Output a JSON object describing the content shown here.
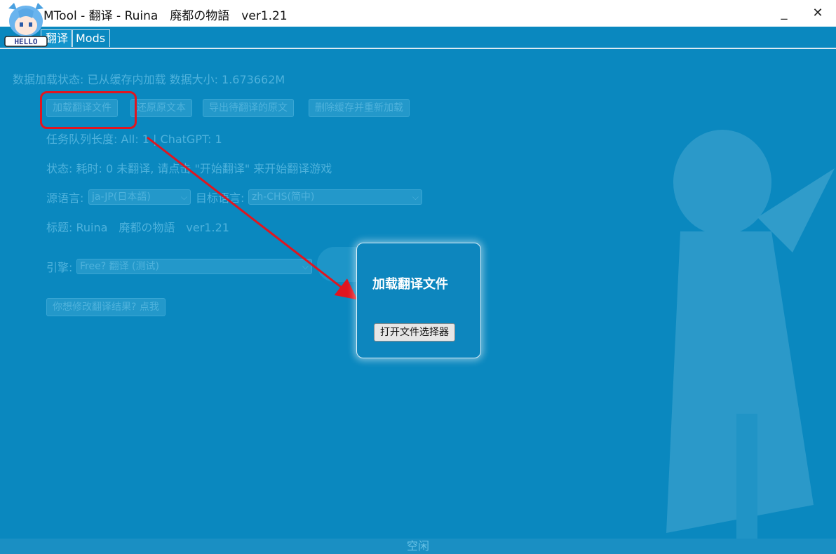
{
  "window": {
    "title": "MTool - 翻译 - Ruina　廃都の物語　ver1.21",
    "minimize_glyph": "_",
    "close_glyph": "✕",
    "mascot_badge": "HELLO"
  },
  "tabs": [
    {
      "label": "翻译",
      "active": true
    },
    {
      "label": "Mods",
      "active": false
    }
  ],
  "main": {
    "load_status": "数据加载状态: 已从缓存内加载 数据大小: 1.673662M",
    "buttons": {
      "load_translation": "加载翻译文件",
      "restore_original": "还原原文本",
      "export_untranslated": "导出待翻译的原文",
      "delete_cache": "删除缓存并重新加载"
    },
    "queue_length": "任务队列长度: All: 1 | ChatGPT: 1",
    "state": "状态: 耗时: 0 未翻译, 请点击 \"开始翻译\" 来开始翻译游戏",
    "source_lang_label": "源语言:",
    "source_lang_value": "ja-JP(日本語)",
    "target_lang_label": "目标语言:",
    "target_lang_value": "zh-CHS(简中)",
    "title_line": "标题: Ruina　廃都の物語　ver1.21",
    "engine_label": "引擎:",
    "engine_value": "Free? 翻译 (测试)",
    "modify_button": "你想修改翻译结果? 点我"
  },
  "modal": {
    "title": "加载翻译文件",
    "open_button": "打开文件选择器"
  },
  "status_bar": {
    "text": "空闲"
  },
  "colors": {
    "window_bg": "#0a88bf",
    "highlight": "#e0151f",
    "modal_bg": "#0d86be"
  },
  "icons": {
    "mascot": "mascot-avatar-icon",
    "dropdown": "chevron-down-icon",
    "close": "close-icon",
    "minimize": "minimize-icon"
  }
}
